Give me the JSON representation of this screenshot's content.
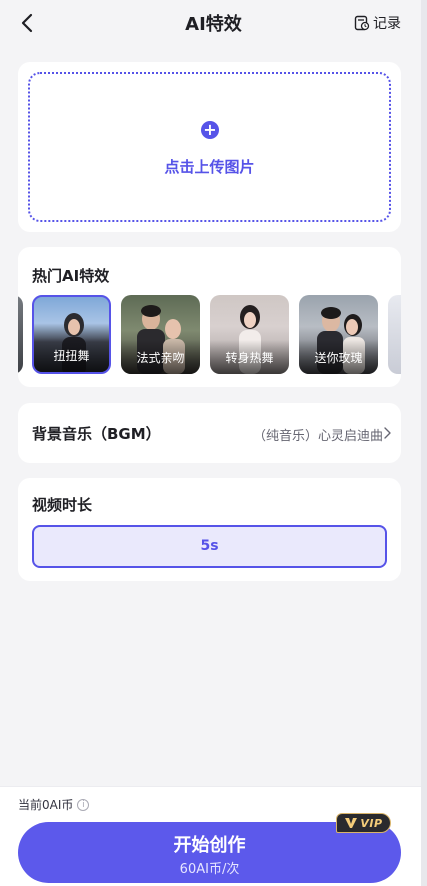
{
  "header": {
    "title": "AI特效",
    "records_label": "记录",
    "back_icon": "chevron-left-icon",
    "records_icon": "record-list-icon"
  },
  "upload": {
    "label": "点击上传图片",
    "icon": "plus-circle-icon"
  },
  "effects": {
    "title": "热门AI特效",
    "items": [
      {
        "label": "扭扭舞",
        "selected": true
      },
      {
        "label": "法式亲吻",
        "selected": false
      },
      {
        "label": "转身热舞",
        "selected": false
      },
      {
        "label": "送你玫瑰",
        "selected": false
      }
    ]
  },
  "bgm": {
    "label": "背景音乐（BGM）",
    "value": "（纯音乐）心灵启迪曲"
  },
  "duration": {
    "title": "视频时长",
    "selected": "5s"
  },
  "footer": {
    "coins_text": "当前0AI币",
    "start_label": "开始创作",
    "price_label": "60AI币/次",
    "vip_text": "VIP"
  },
  "colors": {
    "accent": "#5653e8",
    "background": "#f4f4f6",
    "button": "#5c59eb"
  }
}
